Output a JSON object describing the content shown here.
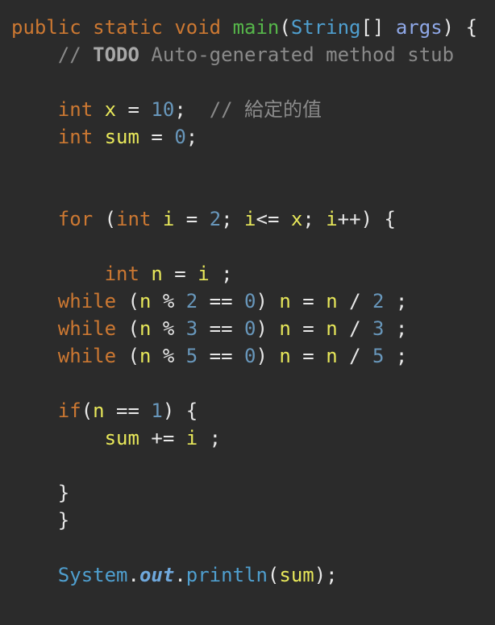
{
  "code_lines": [
    {
      "tokens": [
        {
          "t": "public",
          "c": "kw"
        },
        {
          "t": " ",
          "c": "op"
        },
        {
          "t": "static",
          "c": "kw"
        },
        {
          "t": " ",
          "c": "op"
        },
        {
          "t": "void",
          "c": "kw"
        },
        {
          "t": " ",
          "c": "op"
        },
        {
          "t": "main",
          "c": "fn"
        },
        {
          "t": "(",
          "c": "op"
        },
        {
          "t": "String",
          "c": "type"
        },
        {
          "t": "[] ",
          "c": "op"
        },
        {
          "t": "args",
          "c": "param"
        },
        {
          "t": ") {",
          "c": "op"
        }
      ]
    },
    {
      "tokens": [
        {
          "t": "    // ",
          "c": "com"
        },
        {
          "t": "TODO",
          "c": "todo"
        },
        {
          "t": " Auto-generated method stub",
          "c": "com"
        }
      ]
    },
    {
      "tokens": []
    },
    {
      "tokens": [
        {
          "t": "    ",
          "c": "op"
        },
        {
          "t": "int",
          "c": "kw"
        },
        {
          "t": " ",
          "c": "op"
        },
        {
          "t": "x",
          "c": "var"
        },
        {
          "t": " = ",
          "c": "op"
        },
        {
          "t": "10",
          "c": "num"
        },
        {
          "t": ";  ",
          "c": "op"
        },
        {
          "t": "// 給定的值",
          "c": "com"
        }
      ]
    },
    {
      "tokens": [
        {
          "t": "    ",
          "c": "op"
        },
        {
          "t": "int",
          "c": "kw"
        },
        {
          "t": " ",
          "c": "op"
        },
        {
          "t": "sum",
          "c": "var"
        },
        {
          "t": " = ",
          "c": "op"
        },
        {
          "t": "0",
          "c": "num"
        },
        {
          "t": ";",
          "c": "op"
        }
      ]
    },
    {
      "tokens": []
    },
    {
      "tokens": []
    },
    {
      "tokens": [
        {
          "t": "    ",
          "c": "op"
        },
        {
          "t": "for",
          "c": "kw"
        },
        {
          "t": " (",
          "c": "op"
        },
        {
          "t": "int",
          "c": "kw"
        },
        {
          "t": " ",
          "c": "op"
        },
        {
          "t": "i",
          "c": "var"
        },
        {
          "t": " = ",
          "c": "op"
        },
        {
          "t": "2",
          "c": "num"
        },
        {
          "t": "; ",
          "c": "op"
        },
        {
          "t": "i",
          "c": "var"
        },
        {
          "t": "<= ",
          "c": "op"
        },
        {
          "t": "x",
          "c": "var"
        },
        {
          "t": "; ",
          "c": "op"
        },
        {
          "t": "i",
          "c": "var"
        },
        {
          "t": "++) {",
          "c": "op"
        }
      ]
    },
    {
      "tokens": []
    },
    {
      "tokens": [
        {
          "t": "        ",
          "c": "op"
        },
        {
          "t": "int",
          "c": "kw"
        },
        {
          "t": " ",
          "c": "op"
        },
        {
          "t": "n",
          "c": "var"
        },
        {
          "t": " = ",
          "c": "op"
        },
        {
          "t": "i",
          "c": "var"
        },
        {
          "t": " ;",
          "c": "op"
        }
      ]
    },
    {
      "tokens": [
        {
          "t": "    ",
          "c": "op"
        },
        {
          "t": "while",
          "c": "kw"
        },
        {
          "t": " (",
          "c": "op"
        },
        {
          "t": "n",
          "c": "var"
        },
        {
          "t": " % ",
          "c": "op"
        },
        {
          "t": "2",
          "c": "num"
        },
        {
          "t": " == ",
          "c": "op"
        },
        {
          "t": "0",
          "c": "num"
        },
        {
          "t": ") ",
          "c": "op"
        },
        {
          "t": "n",
          "c": "var"
        },
        {
          "t": " = ",
          "c": "op"
        },
        {
          "t": "n",
          "c": "var"
        },
        {
          "t": " / ",
          "c": "op"
        },
        {
          "t": "2",
          "c": "num"
        },
        {
          "t": " ;",
          "c": "op"
        }
      ]
    },
    {
      "tokens": [
        {
          "t": "    ",
          "c": "op"
        },
        {
          "t": "while",
          "c": "kw"
        },
        {
          "t": " (",
          "c": "op"
        },
        {
          "t": "n",
          "c": "var"
        },
        {
          "t": " % ",
          "c": "op"
        },
        {
          "t": "3",
          "c": "num"
        },
        {
          "t": " == ",
          "c": "op"
        },
        {
          "t": "0",
          "c": "num"
        },
        {
          "t": ") ",
          "c": "op"
        },
        {
          "t": "n",
          "c": "var"
        },
        {
          "t": " = ",
          "c": "op"
        },
        {
          "t": "n",
          "c": "var"
        },
        {
          "t": " / ",
          "c": "op"
        },
        {
          "t": "3",
          "c": "num"
        },
        {
          "t": " ;",
          "c": "op"
        }
      ]
    },
    {
      "tokens": [
        {
          "t": "    ",
          "c": "op"
        },
        {
          "t": "while",
          "c": "kw"
        },
        {
          "t": " (",
          "c": "op"
        },
        {
          "t": "n",
          "c": "var"
        },
        {
          "t": " % ",
          "c": "op"
        },
        {
          "t": "5",
          "c": "num"
        },
        {
          "t": " == ",
          "c": "op"
        },
        {
          "t": "0",
          "c": "num"
        },
        {
          "t": ") ",
          "c": "op"
        },
        {
          "t": "n",
          "c": "var"
        },
        {
          "t": " = ",
          "c": "op"
        },
        {
          "t": "n",
          "c": "var"
        },
        {
          "t": " / ",
          "c": "op"
        },
        {
          "t": "5",
          "c": "num"
        },
        {
          "t": " ;",
          "c": "op"
        }
      ]
    },
    {
      "tokens": []
    },
    {
      "tokens": [
        {
          "t": "    ",
          "c": "op"
        },
        {
          "t": "if",
          "c": "kw"
        },
        {
          "t": "(",
          "c": "op"
        },
        {
          "t": "n",
          "c": "var"
        },
        {
          "t": " == ",
          "c": "op"
        },
        {
          "t": "1",
          "c": "num"
        },
        {
          "t": ") {",
          "c": "op"
        }
      ]
    },
    {
      "tokens": [
        {
          "t": "        ",
          "c": "op"
        },
        {
          "t": "sum",
          "c": "var"
        },
        {
          "t": " += ",
          "c": "op"
        },
        {
          "t": "i",
          "c": "var"
        },
        {
          "t": " ;",
          "c": "op"
        }
      ]
    },
    {
      "tokens": []
    },
    {
      "tokens": [
        {
          "t": "    }",
          "c": "op"
        }
      ]
    },
    {
      "tokens": [
        {
          "t": "    }",
          "c": "op"
        }
      ]
    },
    {
      "tokens": []
    },
    {
      "tokens": [
        {
          "t": "    ",
          "c": "op"
        },
        {
          "t": "System",
          "c": "type"
        },
        {
          "t": ".",
          "c": "op"
        },
        {
          "t": "out",
          "c": "field"
        },
        {
          "t": ".",
          "c": "op"
        },
        {
          "t": "println",
          "c": "type"
        },
        {
          "t": "(",
          "c": "op"
        },
        {
          "t": "sum",
          "c": "var"
        },
        {
          "t": ");",
          "c": "op"
        }
      ]
    }
  ]
}
